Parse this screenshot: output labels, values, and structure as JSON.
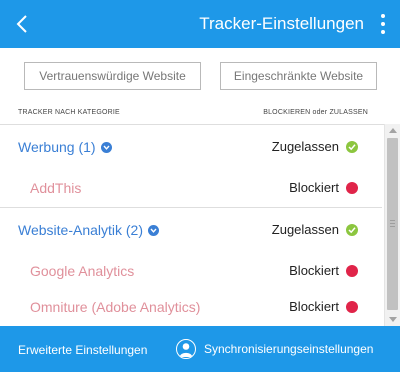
{
  "header": {
    "title": "Tracker-Einstellungen",
    "back_icon": "chevron-left-icon",
    "menu_icon": "more-vertical-icon"
  },
  "buttons": {
    "trusted": "Vertrauenswürdige Website",
    "restricted": "Eingeschränkte Website"
  },
  "columns": {
    "left": "TRACKER NACH KATEGORIE",
    "right": "BLOCKIEREN oder ZULASSEN"
  },
  "categories": [
    {
      "name": "Werbung (1)",
      "status": "Zugelassen",
      "trackers": [
        {
          "name": "AddThis",
          "status": "Blockiert"
        }
      ]
    },
    {
      "name": "Website-Analytik (2)",
      "status": "Zugelassen",
      "trackers": [
        {
          "name": "Google Analytics",
          "status": "Blockiert"
        },
        {
          "name": "Omniture (Adobe Analytics)",
          "status": "Blockiert"
        }
      ]
    }
  ],
  "footer": {
    "advanced": "Erweiterte Einstellungen",
    "sync": "Synchronisierungseinstellungen"
  },
  "colors": {
    "accent": "#1e98e8",
    "category_text": "#3a7fd5",
    "tracker_text": "#e0909b",
    "allowed": "#8cc63f",
    "blocked": "#e02449"
  }
}
